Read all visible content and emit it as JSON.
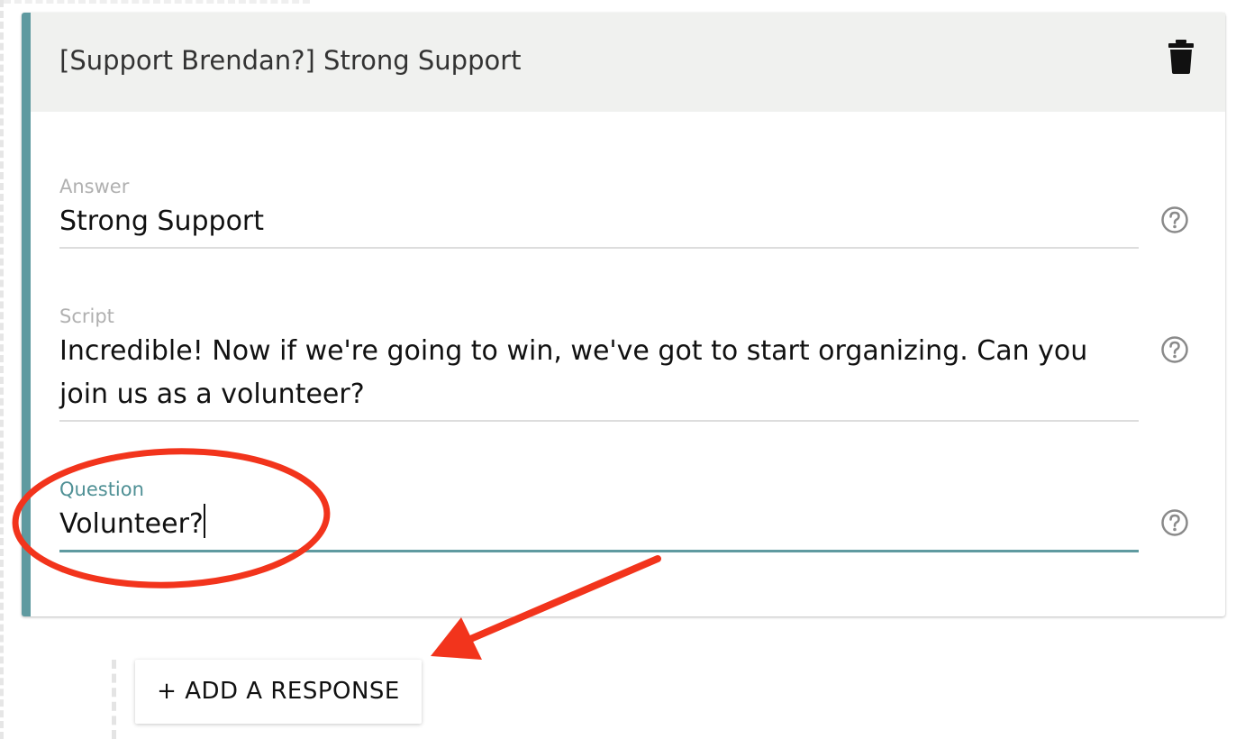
{
  "card": {
    "title": "[Support Brendan?] Strong Support",
    "delete_icon": "trash-icon",
    "help_icon": "question-circle-icon"
  },
  "fields": {
    "answer": {
      "label": "Answer",
      "value": "Strong Support"
    },
    "script": {
      "label": "Script",
      "value": "Incredible! Now if we're going to win, we've got to start organizing. Can you join us as a volunteer?"
    },
    "question": {
      "label": "Question",
      "value": "Volunteer?"
    }
  },
  "add_response": {
    "label": "+ ADD A RESPONSE"
  },
  "colors": {
    "accent": "#5f9aa0",
    "header_bg": "#f0f1ef",
    "annotation": "#f2341c"
  }
}
